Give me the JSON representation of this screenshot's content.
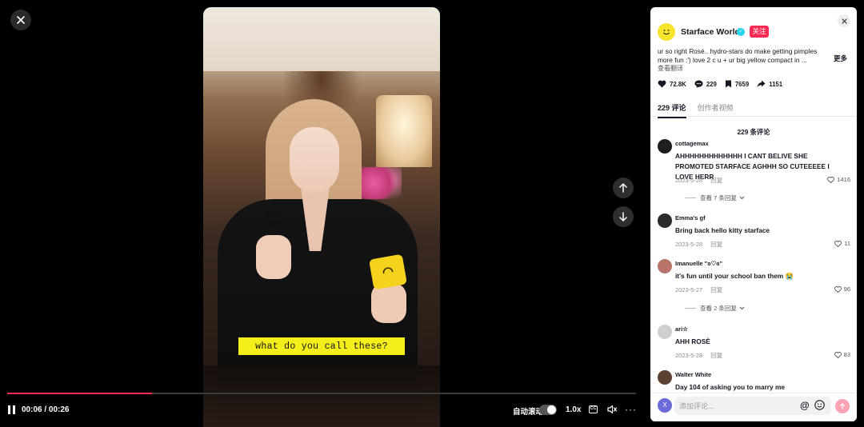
{
  "player": {
    "caption": "what do you call these?",
    "time": "00:06 / 00:26",
    "progress": 0.23,
    "autoscroll_label": "自动滚动",
    "speed": "1.0x",
    "cc": "CC",
    "more": "···"
  },
  "panel": {
    "author": "Starface World",
    "follow": "关注",
    "description": "ur so right Rosé.. hydro-stars do make getting pimples more fun :') love 2 c u + ur big yellow compact in ...",
    "more": "更多",
    "translate": "查看翻译",
    "stats": {
      "likes": "72.8K",
      "comments": "229",
      "saves": "7659",
      "shares": "1151"
    },
    "tabs": [
      "229 评论",
      "创作者视频"
    ],
    "comment_count_heading": "229 条评论",
    "reply_label": "回复",
    "comments": [
      {
        "user": "cottagemax",
        "text": "AHHHHHHHHHHHHH I CANT BELIVE SHE PROMOTED STARFACE AGHHH SO CUTEEEEE I LOVE HERR",
        "date": "2023-5-28",
        "likes": "1416",
        "view_replies": "查看 7 条回复",
        "avatar_color": "#1e1e1e"
      },
      {
        "user": "Emma's gf",
        "text": "Bring back hello kitty starface",
        "date": "2023-5-28",
        "likes": "11",
        "view_replies": "",
        "avatar_color": "#2b2b2b"
      },
      {
        "user": "Imanuelle \"ʚ♡ɞ\"",
        "text": "it's fun until your school ban them 😭",
        "date": "2023-5-27",
        "likes": "96",
        "view_replies": "查看 2 条回复",
        "avatar_color": "#b8746a"
      },
      {
        "user": "ari☆",
        "text": "AHH ROSÈ",
        "date": "2023-5-28",
        "likes": "83",
        "view_replies": "",
        "avatar_color": "#cfcfcf"
      },
      {
        "user": "Walter White",
        "text": "Day 104 of asking you to marry me",
        "date": "",
        "likes": "",
        "view_replies": "",
        "avatar_color": "#5a4030"
      }
    ],
    "input": {
      "placeholder": "添加评论...",
      "me_initial": "X"
    }
  }
}
